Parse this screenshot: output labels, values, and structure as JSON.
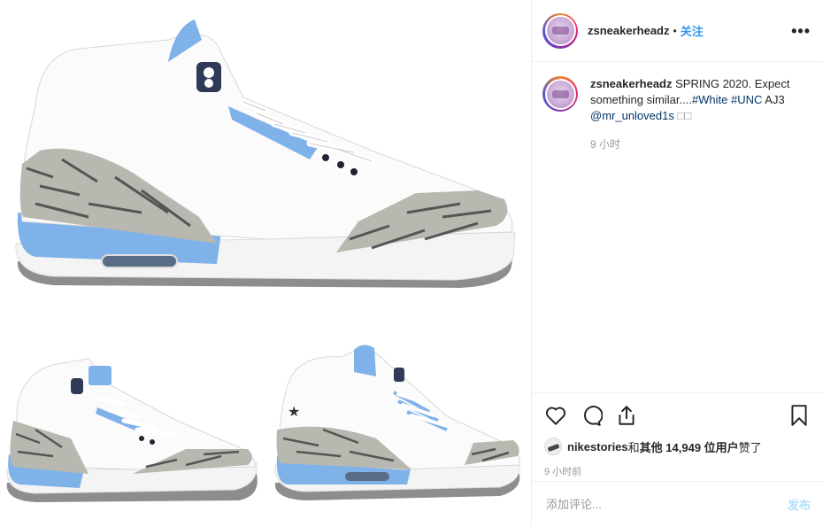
{
  "post": {
    "image_alt": "Air Jordan 3 White UNC sneaker photos",
    "colors": {
      "unc_blue": "#7fb2e8",
      "cement_grey": "#9a9a9a",
      "midsole_white": "#f4f4f4",
      "outsole_grey": "#8d8d8d"
    }
  },
  "header": {
    "username": "zsneakerheadz",
    "separator": "•",
    "follow_label": "关注",
    "more_label": "•••"
  },
  "caption": {
    "username": "zsneakerheadz",
    "text_1": " SPRING 2020. Expect something similar....",
    "hashtag_1": "#White",
    "space": " ",
    "hashtag_2": "#UNC",
    "text_2": " AJ3",
    "mention": "@mr_unloved1s",
    "emoji": " □□",
    "time": "9 小时"
  },
  "actions": {
    "like_icon": "heart-icon",
    "comment_icon": "comment-icon",
    "share_icon": "share-icon",
    "save_icon": "bookmark-icon"
  },
  "likes": {
    "user": "nikestories",
    "and_text": " 和 ",
    "others": "其他 14,949 位用户",
    "liked_text": " 赞了"
  },
  "timestamp": "9 小时前",
  "comment_box": {
    "placeholder": "添加评论...",
    "post_label": "发布"
  }
}
